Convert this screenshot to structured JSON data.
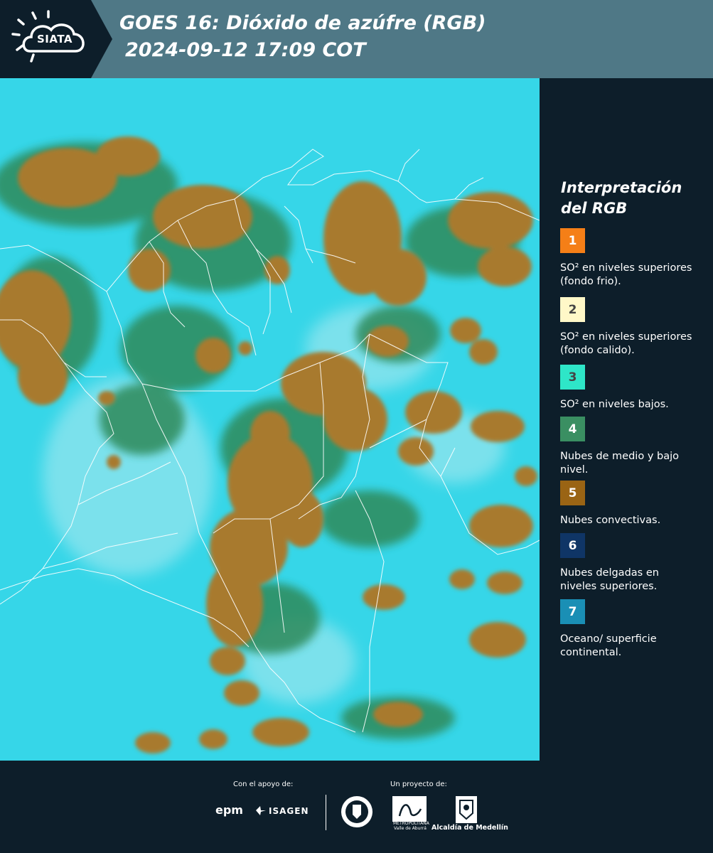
{
  "header": {
    "logo_text": "SIATA",
    "title_line1": "GOES 16: Dióxido de azúfre (RGB)",
    "title_line2": "2024-09-12 17:09 COT"
  },
  "legend": {
    "title_line1": "Interpretación",
    "title_line2": "del RGB",
    "items": [
      {
        "number": "1",
        "color": "#f57f17",
        "text": "SO² en niveles superiores (fondo frio)."
      },
      {
        "number": "2",
        "color": "#fff8c8",
        "text": "SO² en niveles superiores (fondo calido)."
      },
      {
        "number": "3",
        "color": "#2ee6c8",
        "text": "SO² en niveles bajos."
      },
      {
        "number": "4",
        "color": "#3a8f62",
        "text": "Nubes de medio y bajo nivel."
      },
      {
        "number": "5",
        "color": "#9a6414",
        "text": "Nubes convectivas."
      },
      {
        "number": "6",
        "color": "#0f3566",
        "text": "Nubes delgadas en niveles superiores."
      },
      {
        "number": "7",
        "color": "#1a8fb5",
        "text": "Oceano/ superficie continental."
      }
    ]
  },
  "footer": {
    "support_label": "Con el apoyo de:",
    "project_label": "Un proyecto de:",
    "sponsor1": "epm",
    "sponsor2": "ISAGEN",
    "area_label": "METROPOLITANA Valle de Aburrá",
    "alcaldia": "Alcaldía de Medellín"
  },
  "colors": {
    "header_bg": "#4f7886",
    "logo_bg": "#0d1e2a",
    "ocean_cyan": "#36d6e8",
    "cloud_brown": "#a87a2e",
    "cloud_green": "#2e8a5a"
  }
}
